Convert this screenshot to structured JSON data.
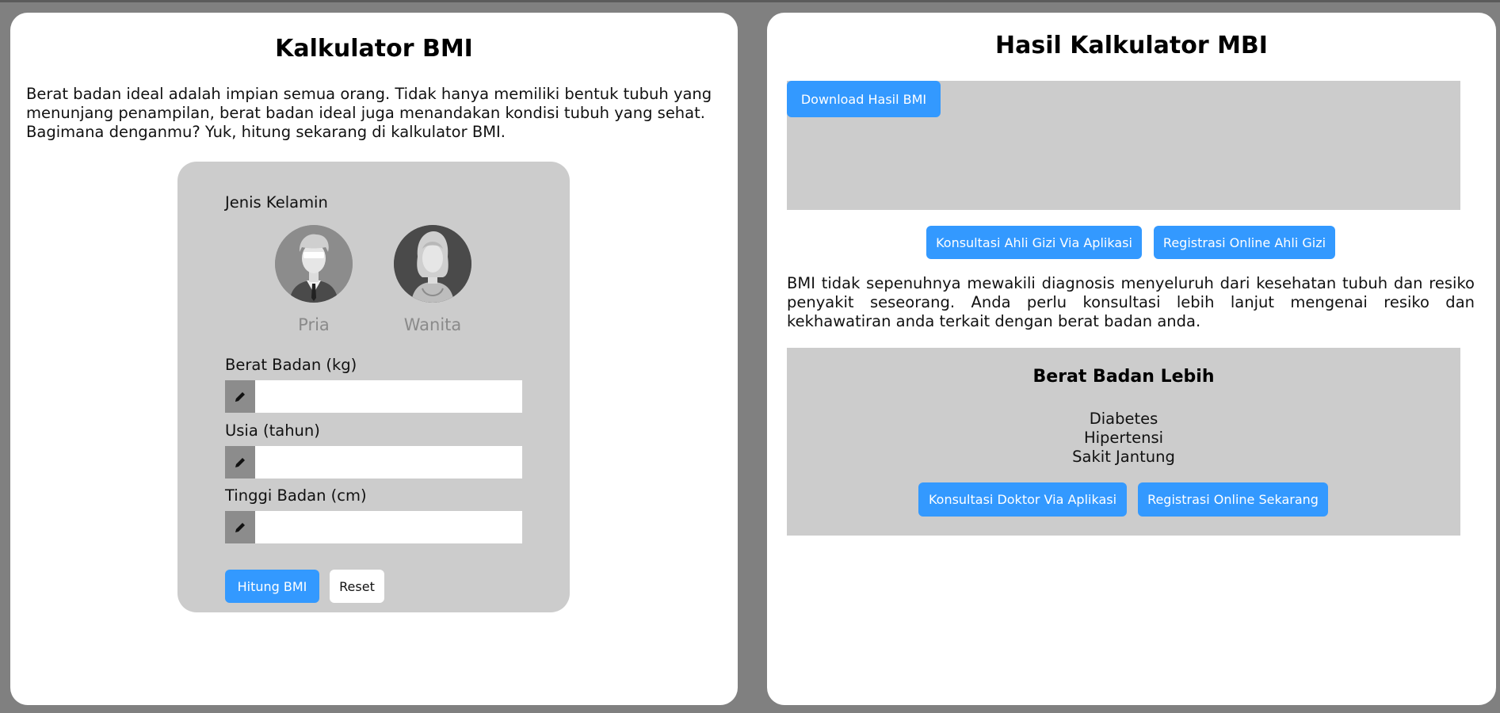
{
  "left_panel": {
    "title": "Kalkulator BMI",
    "intro": "Berat badan ideal adalah impian semua orang. Tidak hanya memiliki bentuk tubuh yang menunjang penampilan, berat badan ideal juga menandakan kondisi tubuh yang sehat. Bagimana denganmu? Yuk, hitung sekarang di kalkulator BMI.",
    "form": {
      "gender_label": "Jenis Kelamin",
      "genders": [
        {
          "label": "Pria",
          "icon": "male-avatar-icon"
        },
        {
          "label": "Wanita",
          "icon": "female-avatar-icon"
        }
      ],
      "fields": [
        {
          "label": "Berat Badan (kg)",
          "value": "",
          "placeholder": "",
          "icon": "pencil-icon"
        },
        {
          "label": "Usia (tahun)",
          "value": "",
          "placeholder": "",
          "icon": "pencil-icon"
        },
        {
          "label": "Tinggi Badan (cm)",
          "value": "",
          "placeholder": "",
          "icon": "pencil-icon"
        }
      ],
      "submit_label": "Hitung BMI",
      "reset_label": "Reset"
    }
  },
  "right_panel": {
    "title": "Hasil Kalkulator MBI",
    "download_label": "Download Hasil BMI",
    "consult_nutrition_label": "Konsultasi Ahli Gizi Via Aplikasi",
    "register_nutrition_label": "Registrasi Online Ahli Gizi",
    "note": "BMI tidak sepenuhnya mewakili diagnosis menyeluruh dari kesehatan tubuh dan resiko penyakit seseorang. Anda perlu konsultasi lebih lanjut mengenai resiko dan kekhawatiran anda terkait dengan berat badan anda.",
    "category": {
      "title": "Berat Badan Lebih",
      "risks": [
        "Diabetes",
        "Hipertensi",
        "Sakit Jantung"
      ],
      "consult_doctor_label": "Konsultasi Doktor Via Aplikasi",
      "register_label": "Registrasi Online Sekarang"
    }
  },
  "colors": {
    "background": "#808080",
    "panel": "#ffffff",
    "card": "#cccccc",
    "accent": "#3399ff",
    "field_icon_bg": "#8c8c8c"
  }
}
